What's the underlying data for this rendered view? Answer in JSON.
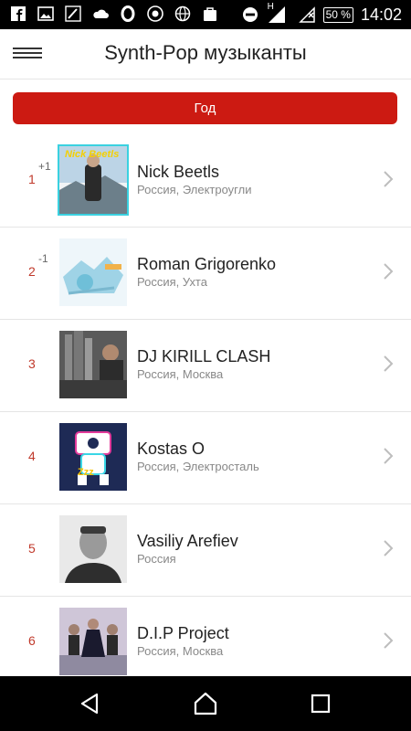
{
  "status": {
    "time": "14:02",
    "battery": "50 %",
    "network_badge": "H",
    "left_icons": [
      "facebook-icon",
      "image-icon",
      "pen-icon",
      "cloud-icon",
      "opera-icon",
      "lion-icon",
      "globe-icon",
      "bag-icon"
    ],
    "right_icons": [
      "do-not-disturb-icon",
      "signal-icon",
      "no-sim-icon"
    ]
  },
  "appbar": {
    "title": "Synth-Pop музыканты"
  },
  "filter": {
    "label": "Год"
  },
  "colors": {
    "accent": "#cc1a12",
    "rank": "#c0392b"
  },
  "artists": [
    {
      "rank": "1",
      "delta": "+1",
      "name": "Nick Beetls",
      "location": "Россия, Электроугли",
      "thumb_text": "Nick Beetls"
    },
    {
      "rank": "2",
      "delta": "-1",
      "name": "Roman Grigorenko",
      "location": "Россия, Ухта",
      "thumb_text": ""
    },
    {
      "rank": "3",
      "delta": "",
      "name": "DJ KIRILL CLASH",
      "location": "Россия, Москва",
      "thumb_text": ""
    },
    {
      "rank": "4",
      "delta": "",
      "name": "Kostas O",
      "location": "Россия, Электросталь",
      "thumb_text": "Zzz"
    },
    {
      "rank": "5",
      "delta": "",
      "name": "Vasiliy Arefiev",
      "location": "Россия",
      "thumb_text": ""
    },
    {
      "rank": "6",
      "delta": "",
      "name": "D.I.P Project",
      "location": "Россия, Москва",
      "thumb_text": ""
    }
  ],
  "nav": {
    "icons": [
      "back-icon",
      "home-icon",
      "recents-icon"
    ]
  }
}
